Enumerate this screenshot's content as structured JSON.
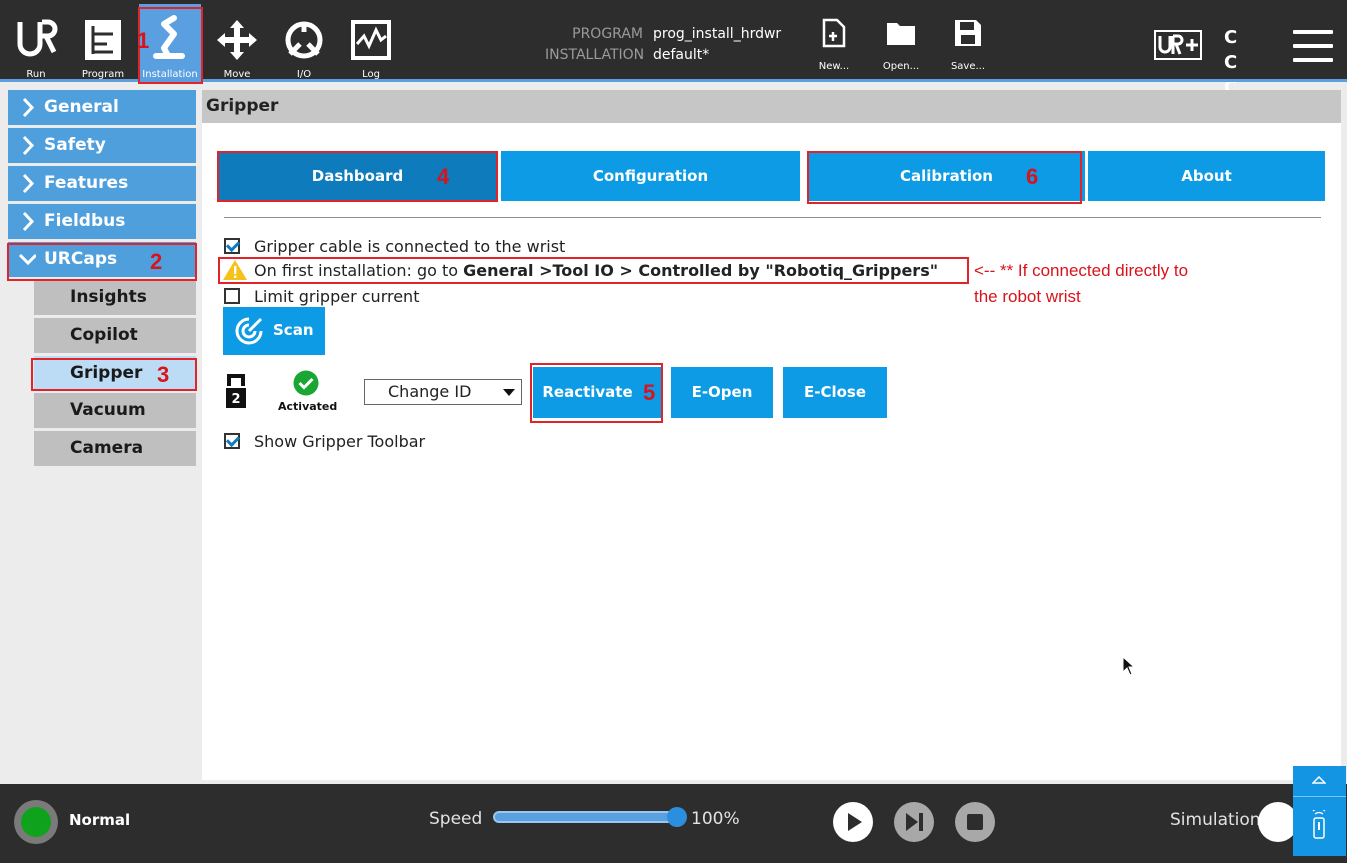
{
  "topbar": {
    "nav": [
      {
        "id": "run",
        "label": "Run"
      },
      {
        "id": "program",
        "label": "Program"
      },
      {
        "id": "installation",
        "label": "Installation",
        "active": true
      },
      {
        "id": "move",
        "label": "Move"
      },
      {
        "id": "io",
        "label": "I/O"
      },
      {
        "id": "log",
        "label": "Log"
      }
    ],
    "program_key": "PROGRAM",
    "program_value": "prog_install_hrdwr",
    "installation_key": "INSTALLATION",
    "installation_value": "default*",
    "file_buttons": [
      {
        "id": "new",
        "label": "New..."
      },
      {
        "id": "open",
        "label": "Open..."
      },
      {
        "id": "save",
        "label": "Save..."
      }
    ],
    "cc_text": "C C C C",
    "icons": [
      "ur-logo-icon",
      "ur-plus-icon",
      "hamburger-icon"
    ]
  },
  "sidebar": {
    "items": [
      {
        "label": "General",
        "expanded": false
      },
      {
        "label": "Safety",
        "expanded": false
      },
      {
        "label": "Features",
        "expanded": false
      },
      {
        "label": "Fieldbus",
        "expanded": false
      },
      {
        "label": "URCaps",
        "expanded": true
      }
    ],
    "sub_items": [
      {
        "label": "Insights"
      },
      {
        "label": "Copilot"
      },
      {
        "label": "Gripper",
        "active": true
      },
      {
        "label": "Vacuum"
      },
      {
        "label": "Camera"
      }
    ]
  },
  "main": {
    "title": "Gripper",
    "tabs": [
      {
        "label": "Dashboard",
        "active": true
      },
      {
        "label": "Configuration"
      },
      {
        "label": "Calibration"
      },
      {
        "label": "About"
      }
    ],
    "cable_checkbox": {
      "label": "Gripper cable is connected to the wrist",
      "checked": true
    },
    "warning_prefix": "On first installation: go to",
    "warning_bold": "General >Tool IO > Controlled by \"Robotiq_Grippers\"",
    "limit_checkbox": {
      "label": "Limit gripper current",
      "checked": false
    },
    "scan_label": "Scan",
    "gripper_number": "2",
    "activated_label": "Activated",
    "change_id": "Change ID",
    "reactivate_label": "Reactivate",
    "eopen_label": "E-Open",
    "eclose_label": "E-Close",
    "toolbar_checkbox": {
      "label": "Show Gripper Toolbar",
      "checked": true
    }
  },
  "annotations": {
    "numbers": [
      "1",
      "2",
      "3",
      "4",
      "5",
      "6"
    ],
    "note_line1": "<-- ** If connected directly to",
    "note_line2": "the robot wrist",
    "color": "#e0242a"
  },
  "bottombar": {
    "status": "Normal",
    "status_color": "#0fa21c",
    "speed_label": "Speed",
    "speed_value": "100%",
    "speed_fraction": 1.0,
    "simulation_label": "Simulation"
  },
  "colors": {
    "accent": "#0d9be6",
    "active_tab": "#0e7bbd",
    "sidebar": "#4f9fdc",
    "dark_bar": "#2d2d2d"
  }
}
